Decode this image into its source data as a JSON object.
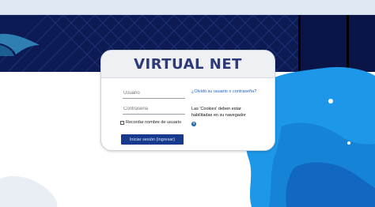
{
  "brand": {
    "title": "VIRTUAL NET"
  },
  "login": {
    "username_placeholder": "Usuario",
    "password_placeholder": "Contraseña",
    "remember_label": "Recordar nombre de usuario",
    "submit_label": "Iniciar sesión (ingresar)",
    "forgot_link": "¿Olvidó su usuario o contraseña?",
    "cookies_notice": "Las 'Cookies' deben estar habilitadas en su navegador",
    "help_icon_glyph": "?"
  },
  "colors": {
    "banner": "#0c1b54",
    "title": "#2d3a78",
    "button": "#173a8f",
    "link": "#1f5fbf",
    "accent_blob": "#1d97e8"
  },
  "icons": {
    "help": "help-icon",
    "checkbox": "checkbox-icon"
  }
}
